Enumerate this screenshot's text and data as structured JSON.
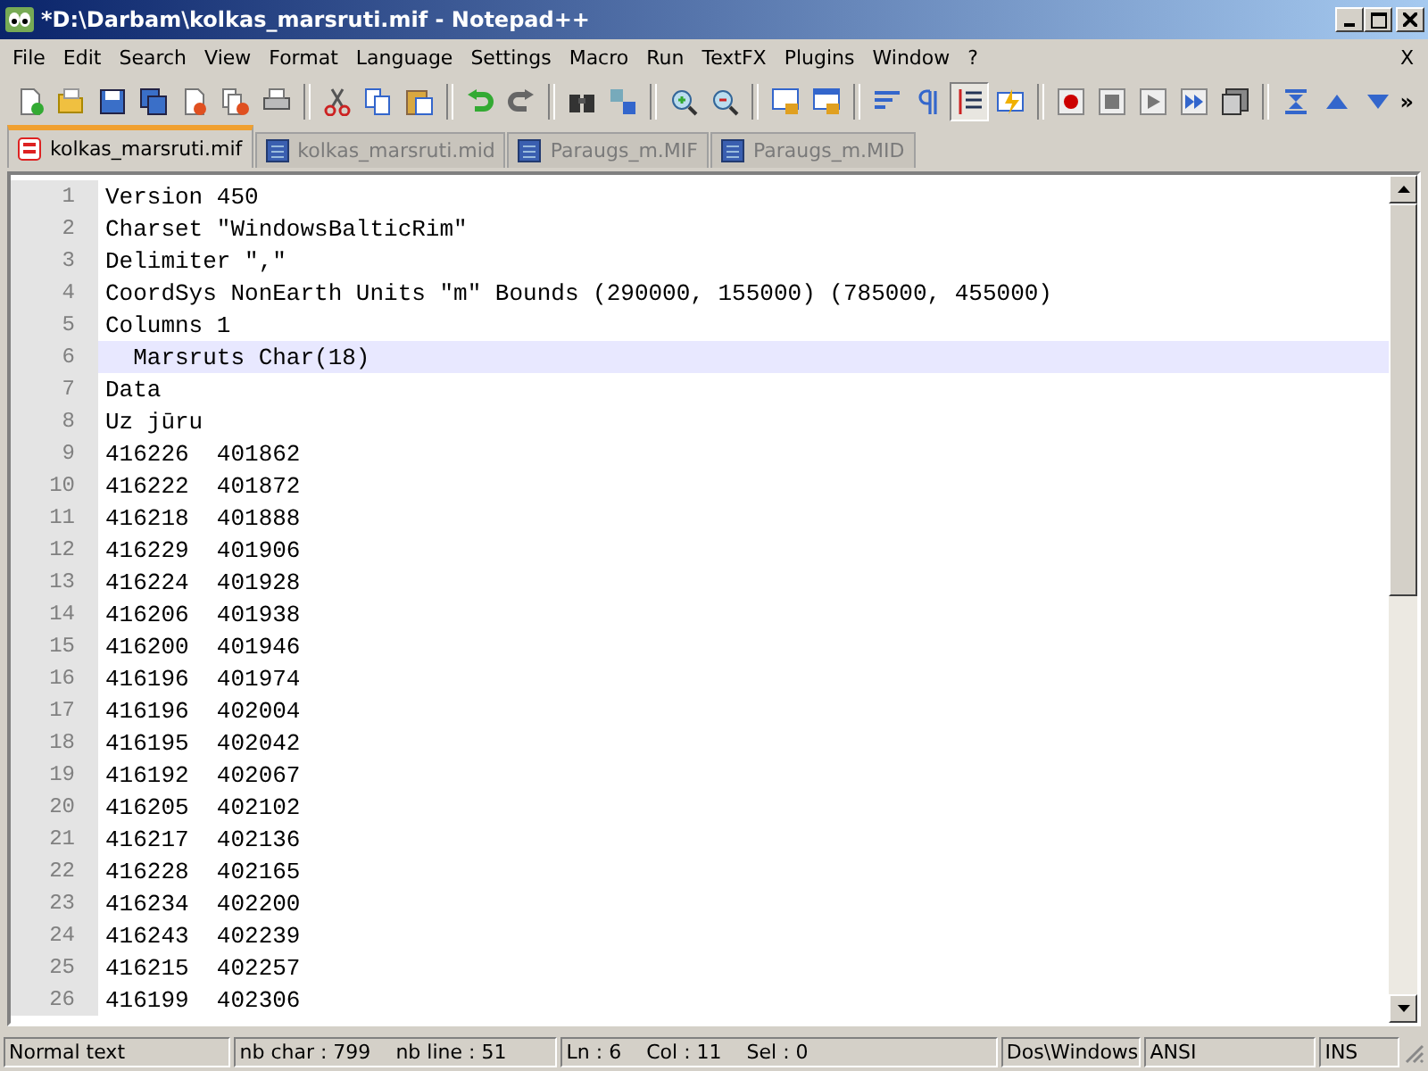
{
  "window": {
    "title": "*D:\\Darbam\\kolkas_marsruti.mif - Notepad++"
  },
  "menu": [
    "File",
    "Edit",
    "Search",
    "View",
    "Format",
    "Language",
    "Settings",
    "Macro",
    "Run",
    "TextFX",
    "Plugins",
    "Window",
    "?"
  ],
  "menu_close": "X",
  "toolbar_buttons": [
    {
      "pressed": false
    },
    {
      "pressed": false
    },
    {
      "pressed": false
    },
    {
      "pressed": false
    },
    {
      "pressed": false
    },
    {
      "pressed": false
    },
    {
      "pressed": false
    },
    {
      "pressed": false
    },
    {
      "pressed": false
    },
    {
      "pressed": false
    },
    {
      "pressed": false
    },
    {
      "pressed": false
    },
    {
      "pressed": false
    },
    {
      "pressed": false
    },
    {
      "pressed": false
    },
    {
      "pressed": false
    },
    {
      "pressed": false
    },
    {
      "pressed": false
    },
    {
      "pressed": false
    },
    {
      "pressed": false
    },
    {
      "pressed": true
    },
    {
      "pressed": false
    },
    {
      "pressed": false
    },
    {
      "pressed": false
    },
    {
      "pressed": false
    },
    {
      "pressed": false
    },
    {
      "pressed": false
    },
    {
      "pressed": false
    },
    {
      "pressed": false
    },
    {
      "pressed": false
    }
  ],
  "toolbar_more": "»",
  "tabs": [
    {
      "label": "kolkas_marsruti.mif",
      "selected": true,
      "modified": true
    },
    {
      "label": "kolkas_marsruti.mid",
      "selected": false,
      "modified": false
    },
    {
      "label": "Paraugs_m.MIF",
      "selected": false,
      "modified": false
    },
    {
      "label": "Paraugs_m.MID",
      "selected": false,
      "modified": false
    }
  ],
  "lines": [
    {
      "number": "1",
      "text": "Version 450",
      "current": false
    },
    {
      "number": "2",
      "text": "Charset \"WindowsBalticRim\"",
      "current": false
    },
    {
      "number": "3",
      "text": "Delimiter \",\"",
      "current": false
    },
    {
      "number": "4",
      "text": "CoordSys NonEarth Units \"m\" Bounds (290000, 155000) (785000, 455000)",
      "current": false
    },
    {
      "number": "5",
      "text": "Columns 1",
      "current": false
    },
    {
      "number": "6",
      "text": "  Marsruts Char(18)",
      "current": true
    },
    {
      "number": "7",
      "text": "Data",
      "current": false
    },
    {
      "number": "8",
      "text": "Uz jūru",
      "current": false
    },
    {
      "number": "9",
      "text": "416226  401862",
      "current": false
    },
    {
      "number": "10",
      "text": "416222  401872",
      "current": false
    },
    {
      "number": "11",
      "text": "416218  401888",
      "current": false
    },
    {
      "number": "12",
      "text": "416229  401906",
      "current": false
    },
    {
      "number": "13",
      "text": "416224  401928",
      "current": false
    },
    {
      "number": "14",
      "text": "416206  401938",
      "current": false
    },
    {
      "number": "15",
      "text": "416200  401946",
      "current": false
    },
    {
      "number": "16",
      "text": "416196  401974",
      "current": false
    },
    {
      "number": "17",
      "text": "416196  402004",
      "current": false
    },
    {
      "number": "18",
      "text": "416195  402042",
      "current": false
    },
    {
      "number": "19",
      "text": "416192  402067",
      "current": false
    },
    {
      "number": "20",
      "text": "416205  402102",
      "current": false
    },
    {
      "number": "21",
      "text": "416217  402136",
      "current": false
    },
    {
      "number": "22",
      "text": "416228  402165",
      "current": false
    },
    {
      "number": "23",
      "text": "416234  402200",
      "current": false
    },
    {
      "number": "24",
      "text": "416243  402239",
      "current": false
    },
    {
      "number": "25",
      "text": "416215  402257",
      "current": false
    },
    {
      "number": "26",
      "text": "416199  402306",
      "current": false
    }
  ],
  "status_bar": [
    {
      "texts": [
        "Normal text"
      ]
    },
    {
      "texts": [
        "nb char : 799",
        "nb line : 51"
      ]
    },
    {
      "texts": [
        "Ln : 6",
        "Col : 11",
        "Sel : 0"
      ]
    },
    {
      "texts": [
        "Dos\\Windows"
      ]
    },
    {
      "texts": [
        "ANSI"
      ]
    },
    {
      "texts": [
        "INS"
      ]
    }
  ]
}
